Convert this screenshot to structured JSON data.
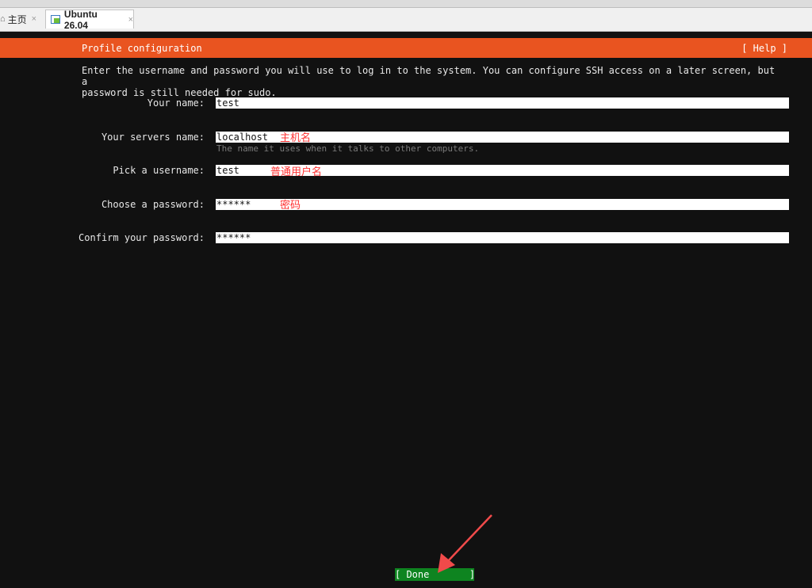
{
  "tabs": [
    {
      "label": "主页",
      "close": "×"
    },
    {
      "label": "Ubuntu 26.04",
      "close": "×"
    }
  ],
  "header": {
    "title": "Profile configuration",
    "help_label": "[ Help ]"
  },
  "intro": "Enter the username and password you will use to log in to the system. You can configure SSH access on a later screen, but a\npassword is still needed for sudo.",
  "form": {
    "your_name": {
      "label": "Your name:",
      "value": "test"
    },
    "server_name": {
      "label": "Your servers name:",
      "value": "localhost",
      "hint": "The name it uses when it talks to other computers."
    },
    "username": {
      "label": "Pick a username:",
      "value": "test"
    },
    "password": {
      "label": "Choose a password:",
      "value": "******"
    },
    "confirm_password": {
      "label": "Confirm your password:",
      "value": "******"
    }
  },
  "annotations": {
    "server_name": "主机名",
    "username": "普通用户名",
    "password": "密码"
  },
  "done_label": "[ Done       ]",
  "colors": {
    "accent": "#e95420",
    "done_bg": "#0e8420",
    "background": "#111111",
    "annotation": "#ff3030"
  },
  "icons": {
    "home": "home-icon",
    "vm": "vm-icon",
    "arrow": "arrow-annotation"
  }
}
